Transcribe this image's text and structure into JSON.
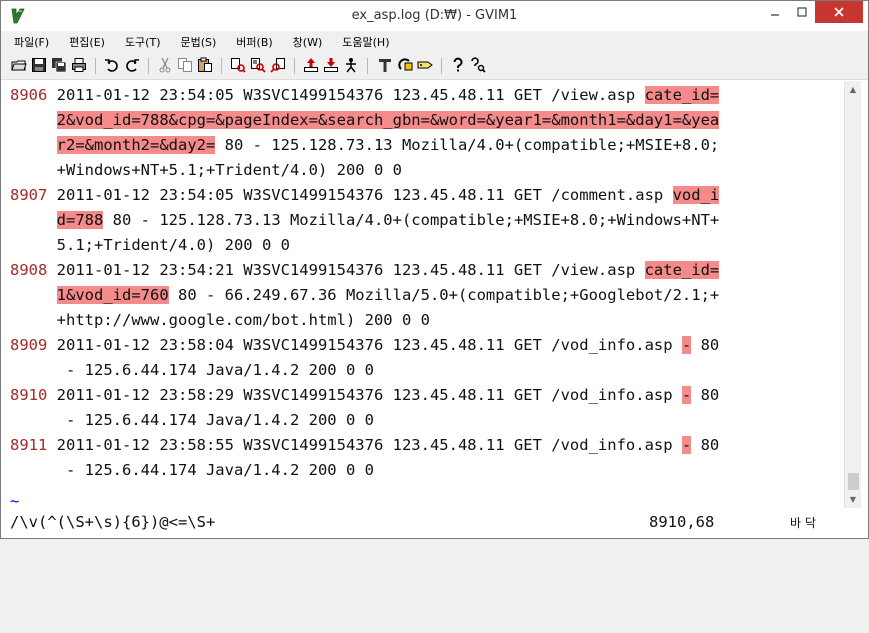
{
  "window": {
    "title": "ex_asp.log (D:₩) - GVIM1"
  },
  "menu": [
    "파일(F)",
    "편집(E)",
    "도구(T)",
    "문법(S)",
    "버퍼(B)",
    "창(W)",
    "도움말(H)"
  ],
  "lines": [
    {
      "num": "8906",
      "rows": [
        [
          {
            "t": "2011-01-12 23:54:05 W3SVC1499154376 123.45.48.11 GET /view.asp "
          },
          {
            "t": "cate_id=",
            "hl": true
          }
        ],
        [
          {
            "t": "2&vod_id=788&cpg=&pageIndex=&search_gbn=&word=&year1=&month1=&day1=&yea",
            "hl": true
          }
        ],
        [
          {
            "t": "r2=&month2=&day2=",
            "hl": true
          },
          {
            "t": " 80 - 125.128.73.13 Mozilla/4.0+(compatible;+MSIE+8.0;"
          }
        ],
        [
          {
            "t": "+Windows+NT+5.1;+Trident/4.0) 200 0 0"
          }
        ]
      ]
    },
    {
      "num": "8907",
      "rows": [
        [
          {
            "t": "2011-01-12 23:54:05 W3SVC1499154376 123.45.48.11 GET /comment.asp "
          },
          {
            "t": "vod_i",
            "hl": true
          }
        ],
        [
          {
            "t": "d=788",
            "hl": true
          },
          {
            "t": " 80 - 125.128.73.13 Mozilla/4.0+(compatible;+MSIE+8.0;+Windows+NT+"
          }
        ],
        [
          {
            "t": "5.1;+Trident/4.0) 200 0 0"
          }
        ]
      ]
    },
    {
      "num": "8908",
      "rows": [
        [
          {
            "t": "2011-01-12 23:54:21 W3SVC1499154376 123.45.48.11 GET /view.asp "
          },
          {
            "t": "cate_id=",
            "hl": true
          }
        ],
        [
          {
            "t": "1&vod_id=760",
            "hl": true
          },
          {
            "t": " 80 - 66.249.67.36 Mozilla/5.0+(compatible;+Googlebot/2.1;+"
          }
        ],
        [
          {
            "t": "+http://www.google.com/bot.html) 200 0 0"
          }
        ]
      ]
    },
    {
      "num": "8909",
      "rows": [
        [
          {
            "t": "2011-01-12 23:58:04 W3SVC1499154376 123.45.48.11 GET /vod_info.asp "
          },
          {
            "t": "-",
            "hl": true
          },
          {
            "t": " 80"
          }
        ],
        [
          {
            "t": " - 125.6.44.174 Java/1.4.2 200 0 0"
          }
        ]
      ]
    },
    {
      "num": "8910",
      "rows": [
        [
          {
            "t": "2011-01-12 23:58:29 W3SVC1499154376 123.45.48.11 GET /vod_info.asp "
          },
          {
            "t": "-",
            "hl": true
          },
          {
            "t": " 80"
          }
        ],
        [
          {
            "t": " - 125.6.44.174 Java/1.4.2 200 0 0"
          }
        ]
      ]
    },
    {
      "num": "8911",
      "rows": [
        [
          {
            "t": "2011-01-12 23:58:55 W3SVC1499154376 123.45.48.11 GET /vod_info.asp "
          },
          {
            "t": "-",
            "hl": true
          },
          {
            "t": " 80"
          }
        ],
        [
          {
            "t": " - 125.6.44.174 Java/1.4.2 200 0 0"
          }
        ]
      ]
    }
  ],
  "tilde": "~",
  "status": {
    "command": "/\\v(^(\\S+\\s){6})@<=\\S+",
    "position": "8910,68",
    "scroll": "바 닥"
  },
  "toolbar_icons": [
    "open-icon",
    "save-icon",
    "save-all-icon",
    "print-icon",
    "undo-icon",
    "redo-icon",
    "cut-icon",
    "copy-icon",
    "paste-icon",
    "find-replace-icon",
    "find-next-icon",
    "find-prev-icon",
    "load-session-icon",
    "save-session-icon",
    "run-script-icon",
    "make-icon",
    "shell-icon",
    "ctags-icon",
    "help-icon",
    "find-help-icon"
  ],
  "colors": {
    "highlight": "#f48a8a",
    "line_number": "#a52a2a",
    "tilde": "#0000ff",
    "close_button": "#c7372f"
  }
}
